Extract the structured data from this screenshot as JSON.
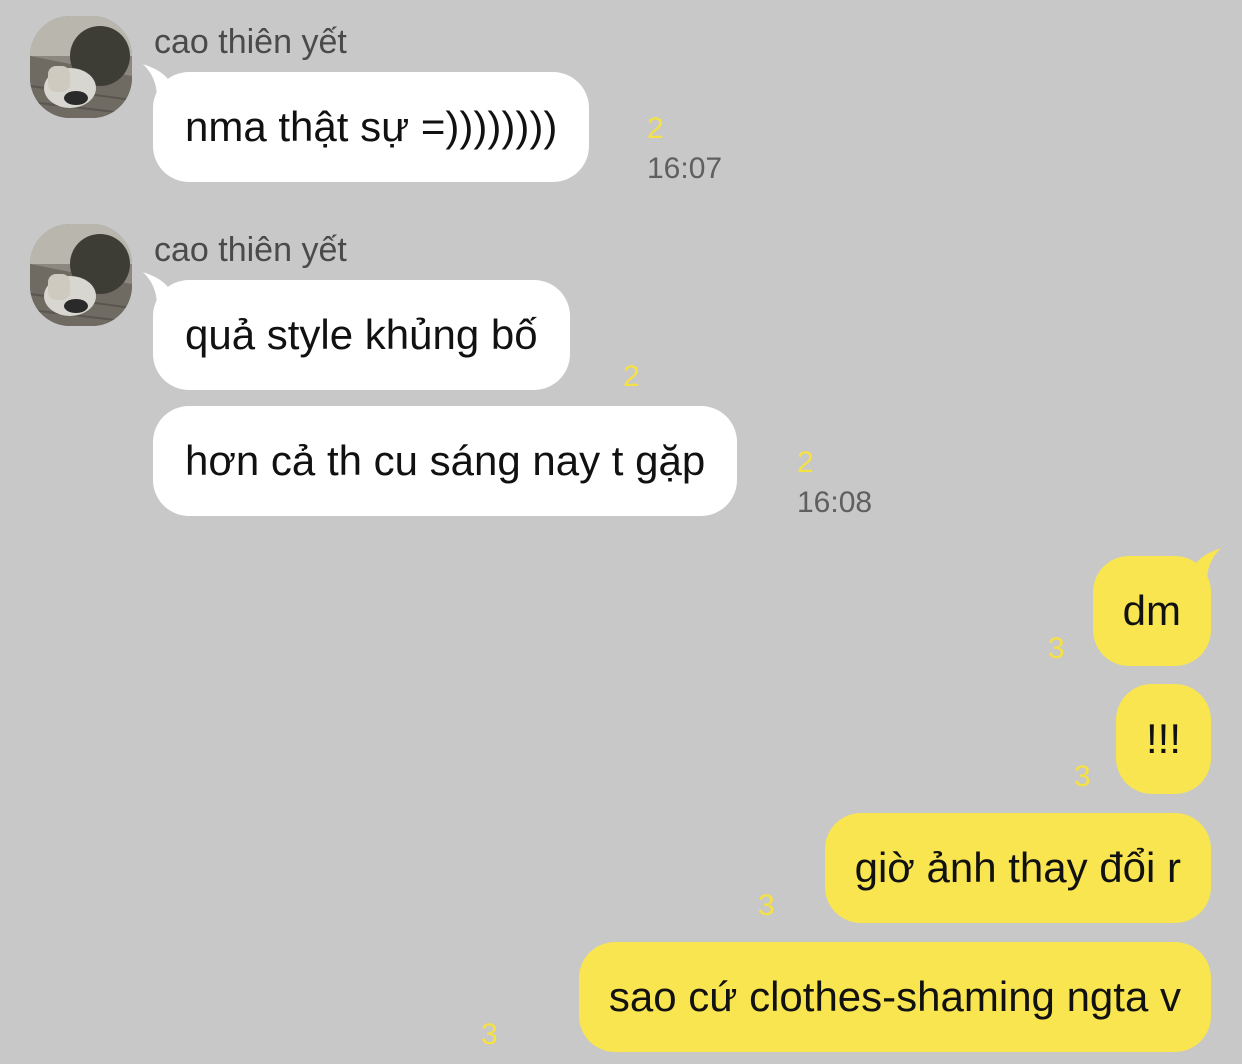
{
  "colors": {
    "background": "#c8c8c8",
    "incoming_bubble": "#ffffff",
    "outgoing_bubble": "#f8e54f",
    "unread_count": "#f5e142",
    "timestamp": "#5f5f5f",
    "sender_name": "#4a4a4a"
  },
  "incoming": [
    {
      "sender": "cao thiên yết",
      "avatar_icon": "profile-photo-avatar",
      "messages": [
        {
          "text": "nma thật sự =))))))))",
          "unread": "2",
          "time": "16:07"
        }
      ]
    },
    {
      "sender": "cao thiên yết",
      "avatar_icon": "profile-photo-avatar",
      "messages": [
        {
          "text": "quả style khủng bố",
          "unread": "2"
        },
        {
          "text": "hơn cả th cu sáng nay t gặp",
          "unread": "2",
          "time": "16:08"
        }
      ]
    }
  ],
  "outgoing": [
    {
      "text": "dm",
      "unread": "3"
    },
    {
      "text": "!!!",
      "unread": "3"
    },
    {
      "text": "giờ ảnh thay đổi r",
      "unread": "3"
    },
    {
      "text": "sao cứ clothes-shaming ngta v",
      "unread": "3"
    }
  ]
}
